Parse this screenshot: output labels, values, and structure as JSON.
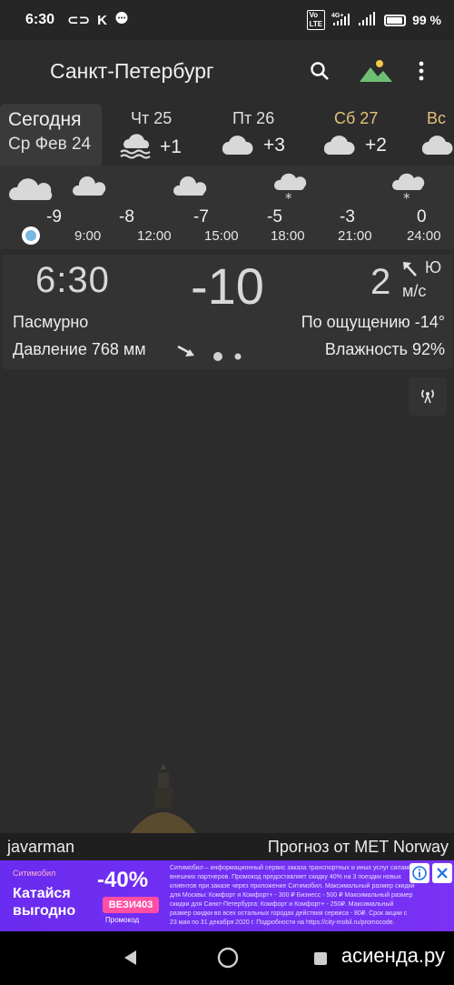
{
  "status": {
    "time": "6:30",
    "icons": [
      "link-icon",
      "k-icon",
      "chat-icon"
    ],
    "right": [
      "volte-icon",
      "4g-signal-icon",
      "wifi-icon",
      "battery-icon"
    ],
    "battery": "99 %"
  },
  "header": {
    "city": "Санкт-Петербург",
    "icons": [
      "search-icon",
      "landscape-icon",
      "more-icon"
    ]
  },
  "today": {
    "label": "Сегодня",
    "date": "Ср Фев 24"
  },
  "days": [
    {
      "label": "Чт 25",
      "temp": "+1",
      "icon": "fog-cloud-icon"
    },
    {
      "label": "Пт 26",
      "temp": "+3",
      "icon": "cloud-icon"
    },
    {
      "label": "Сб 27",
      "temp": "+2",
      "icon": "cloud-icon"
    },
    {
      "label": "Вс",
      "temp": "",
      "icon": "cloud-icon"
    }
  ],
  "hourly": {
    "temps": [
      "-9",
      "-8",
      "-7",
      "-5",
      "-3",
      "0"
    ],
    "times": [
      "9:00",
      "12:00",
      "15:00",
      "18:00",
      "21:00",
      "24:00"
    ]
  },
  "current": {
    "time": "6:30",
    "temp": "-10",
    "wind_speed": "2",
    "wind_dir": "Ю",
    "wind_unit": "м/с",
    "condition": "Пасмурно",
    "feels_like": "По ощущению -14°",
    "pressure": "Давление 768 мм",
    "humidity": "Влажность 92%"
  },
  "footer": {
    "user": "javarman",
    "source": "Прогноз от MET Norway"
  },
  "ad": {
    "brand": "Ситимобил",
    "slogan": "Катайся выгодно",
    "discount": "-40%",
    "promo_code": "ВЕЗИ403",
    "promo_label": "Промокод",
    "fine_print": "Ситимобил – информационный сервис заказа транспортных и иных услуг силами внешних партнеров. Промокод предоставляет скидку 40% на 3 поездки новых клиентов при заказе через приложение Ситимобил. Максимальный размер скидки для Москвы: Комфорт и Комфорт+ - 300 ₽ Бизнесс - 500 ₽ Максимальный размер скидки для Санкт-Петербурга: Комфорт и Комфорт+ - 250₽. Максимальный размер скидки во всех остальных городах действия сервиса - 80₽. Срок акции с 23 мая по 31 декабря 2020 г. Подробности на https://city-mobil.ru/promocode."
  },
  "watermark": "асиенда.ру",
  "colors": {
    "background": "#2c2c2c",
    "panel": "#333333",
    "saturday": "#e2c27a",
    "now_marker": "#7ab8e0",
    "ad_background": "#6a2cf0",
    "ad_code": "#ff4fa3"
  }
}
